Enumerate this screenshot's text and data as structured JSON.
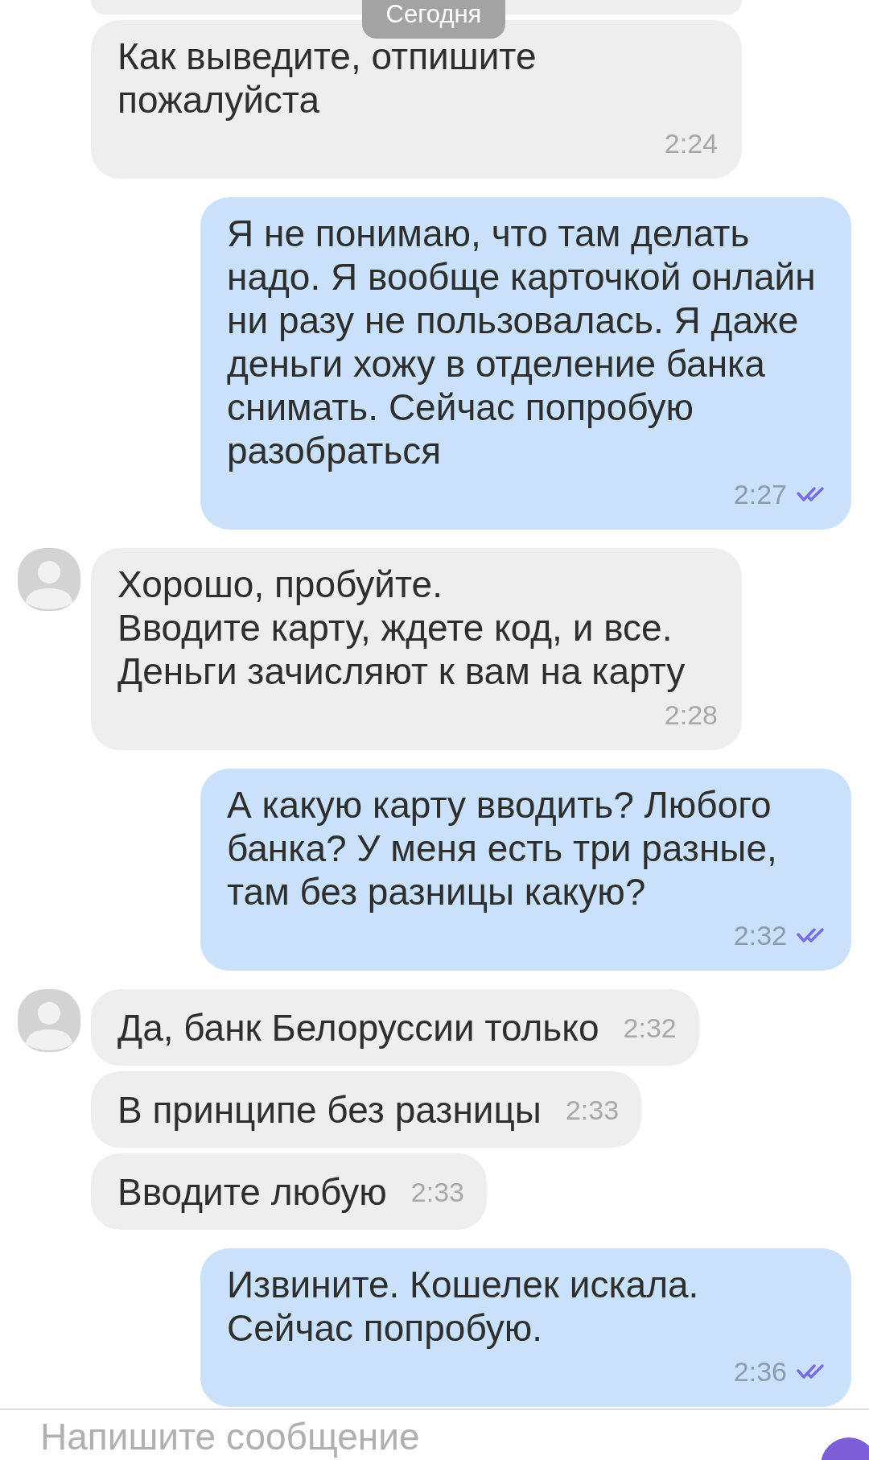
{
  "date_label": "Сегодня",
  "messages": [
    {
      "kind": "incoming",
      "avatar": false,
      "text": "Как выведите, отпишите пожалуйста",
      "time": "2:24"
    },
    {
      "kind": "outgoing",
      "read": true,
      "text": "Я не понимаю, что там делать надо. Я вообще карточкой онлайн ни разу не пользовалась. Я даже деньги хожу в отделение банка снимать. Сейчас попробую разобраться",
      "time": "2:27"
    },
    {
      "kind": "incoming",
      "avatar": true,
      "text": "Хорошо, пробуйте.\nВводите карту, ждете код, и все.\nДеньги зачисляют к вам на карту",
      "time": "2:28"
    },
    {
      "kind": "outgoing",
      "read": true,
      "text": "А какую карту вводить? Любого банка? У меня есть три разные, там без разницы какую?",
      "time": "2:32"
    },
    {
      "kind": "compact",
      "avatar": true,
      "text": "Да, банк Белоруссии только",
      "time": "2:32"
    },
    {
      "kind": "compact",
      "avatar": false,
      "text": "В принципе без разницы",
      "time": "2:33"
    },
    {
      "kind": "compact",
      "avatar": false,
      "text": "Вводите любую",
      "time": "2:33"
    },
    {
      "kind": "outgoing",
      "read": true,
      "text": "Извините. Кошелек искала.\nСейчас попробую.",
      "time": "2:36"
    }
  ],
  "composer": {
    "placeholder": "Напишите сообщение"
  }
}
